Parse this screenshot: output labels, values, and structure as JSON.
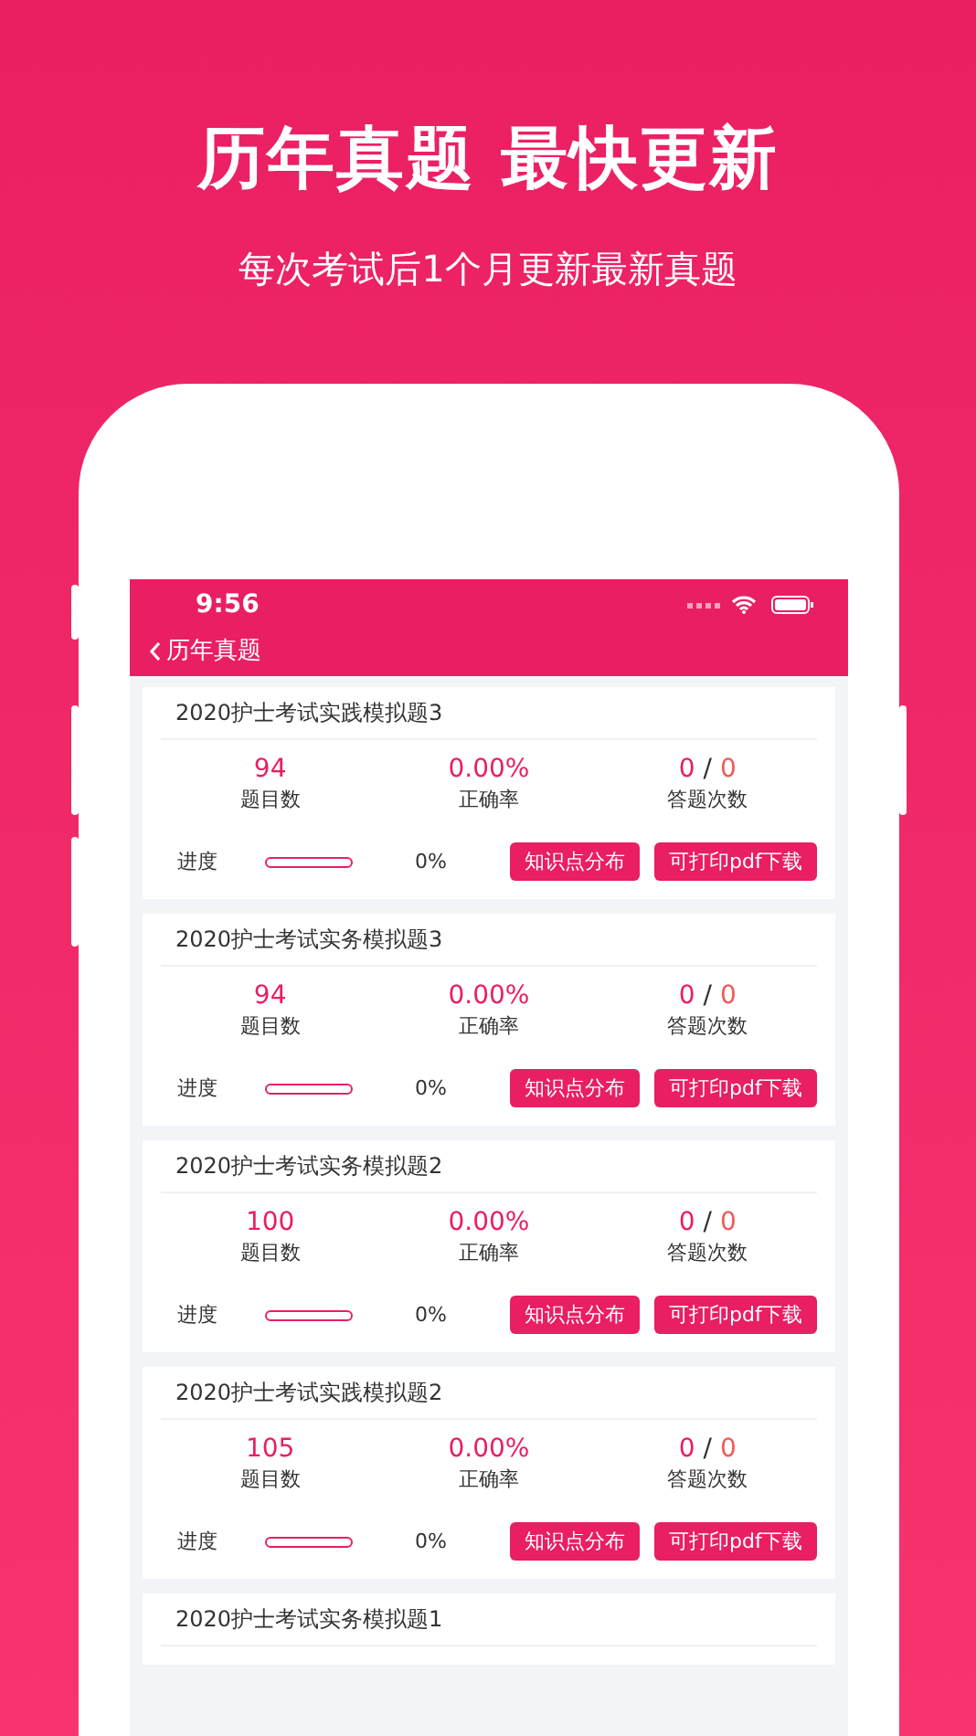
{
  "headline": "历年真题 最快更新",
  "subtitle": "每次考试后1个月更新最新真题",
  "status_bar": {
    "time": "9:56"
  },
  "nav": {
    "back": "历年真题"
  },
  "papers": [
    {
      "title": "2020护士考试实践模拟题3",
      "questions": "94",
      "questions_label": "题目数",
      "accuracy": "0.00%",
      "accuracy_label": "正确率",
      "answered": "0",
      "separator": "/",
      "attempts": "0",
      "attempts_label": "答题次数",
      "progress_label": "进度",
      "level": 0,
      "progress": "0%",
      "buttons": [
        "知识点分布",
        "可打印pdf下载"
      ]
    },
    {
      "title": "2020护士考试实务模拟题3",
      "questions": "94",
      "questions_label": "题目数",
      "accuracy": "0.00%",
      "accuracy_label": "正确率",
      "answered": "0",
      "separator": "/",
      "attempts": "0",
      "attempts_label": "答题次数",
      "progress_label": "进度",
      "level": 0,
      "progress": "0%",
      "buttons": [
        "知识点分布",
        "可打印pdf下载"
      ]
    },
    {
      "title": "2020护士考试实务模拟题2",
      "questions": "100",
      "questions_label": "题目数",
      "accuracy": "0.00%",
      "accuracy_label": "正确率",
      "answered": "0",
      "separator": "/",
      "attempts": "0",
      "attempts_label": "答题次数",
      "progress_label": "进度",
      "level": 0,
      "progress": "0%",
      "buttons": [
        "知识点分布",
        "可打印pdf下载"
      ]
    },
    {
      "title": "2020护士考试实践模拟题2",
      "questions": "105",
      "questions_label": "题目数",
      "accuracy": "0.00%",
      "accuracy_label": "正确率",
      "answered": "0",
      "separator": "/",
      "attempts": "0",
      "attempts_label": "答题次数",
      "progress_label": "进度",
      "level": 0,
      "progress": "0%",
      "buttons": [
        "知识点分布",
        "可打印pdf下载"
      ]
    },
    {
      "title": "2020护士考试实务模拟题1"
    }
  ]
}
